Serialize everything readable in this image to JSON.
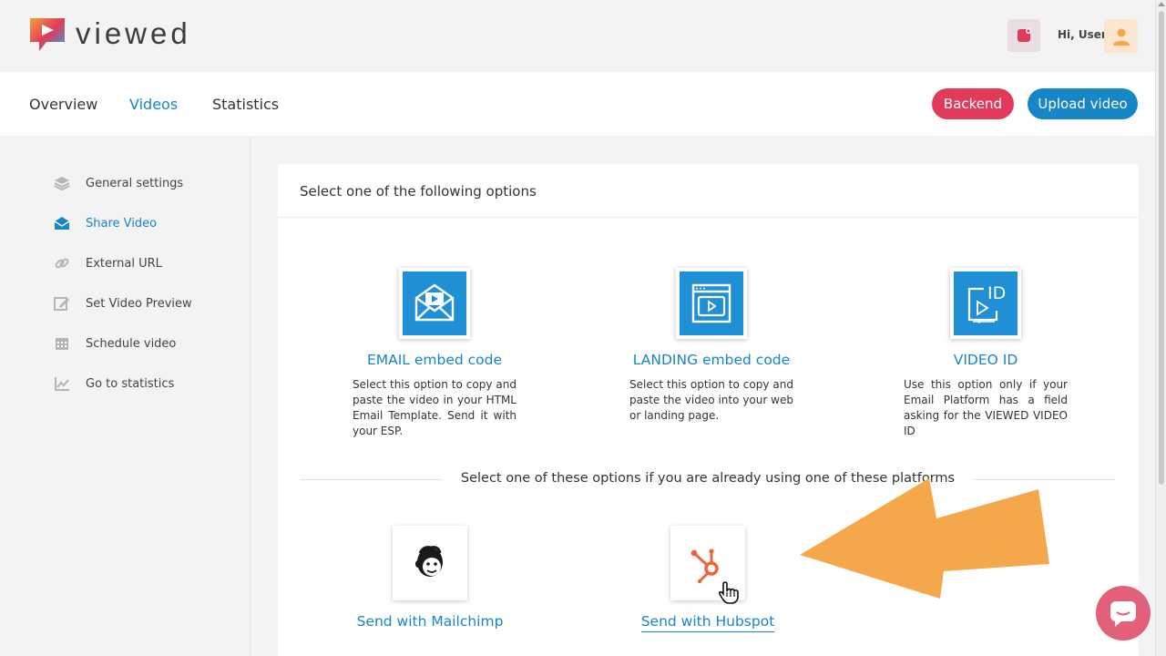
{
  "app": {
    "brand": "viewed",
    "greeting": "Hi, User"
  },
  "nav": {
    "tabs": [
      {
        "label": "Overview"
      },
      {
        "label": "Videos",
        "active": true
      },
      {
        "label": "Statistics"
      }
    ],
    "backend_label": "Backend",
    "upload_label": "Upload video"
  },
  "sidebar": {
    "items": [
      {
        "label": "General settings",
        "icon": "layers-icon"
      },
      {
        "label": "Share Video",
        "icon": "envelope-icon",
        "active": true
      },
      {
        "label": "External URL",
        "icon": "link-icon"
      },
      {
        "label": "Set Video Preview",
        "icon": "edit-icon"
      },
      {
        "label": "Schedule video",
        "icon": "calendar-icon"
      },
      {
        "label": "Go to statistics",
        "icon": "chart-icon"
      }
    ]
  },
  "main": {
    "title": "Select one of the following options",
    "options": [
      {
        "title": "EMAIL embed code",
        "desc": "Select this option to copy and paste the video in your HTML Email Template. Send it with your ESP."
      },
      {
        "title": "LANDING embed code",
        "desc": "Select this option to copy and paste the video into your web or landing page."
      },
      {
        "title": "VIDEO ID",
        "desc": "Use this option only if your Email Platform has a field asking for the VIEWED VIDEO ID",
        "icon_text": "ID"
      }
    ],
    "platforms_text": "Select one of these options if you are already using one of these platforms",
    "platforms": [
      {
        "title": "Send with Mailchimp"
      },
      {
        "title": "Send with Hubspot"
      }
    ]
  },
  "colors": {
    "accent": "#1786c7",
    "backend": "#e23a5a",
    "arrow": "#f5a84a",
    "chat": "#e2607a"
  }
}
